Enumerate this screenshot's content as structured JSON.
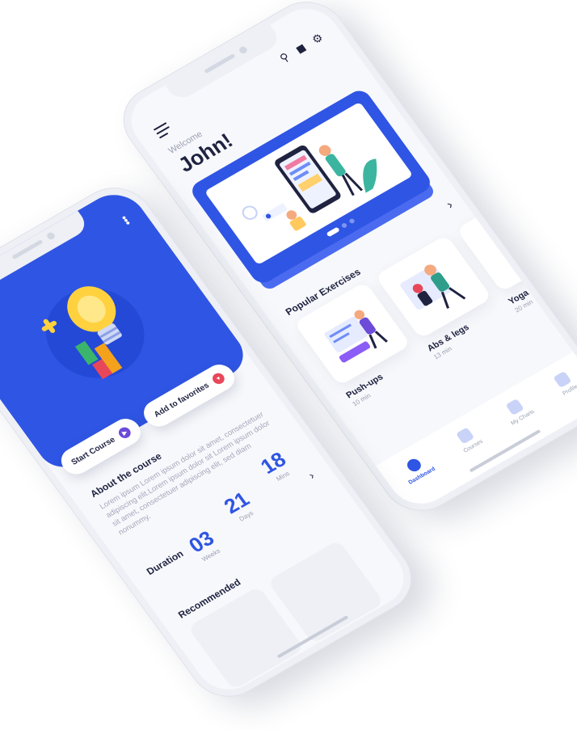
{
  "dashboard": {
    "welcome_label": "Welcome",
    "user_name": "John!",
    "section_title": "Popular Exercises",
    "exercises": [
      {
        "name": "Push-ups",
        "duration": "10 min"
      },
      {
        "name": "Abs & legs",
        "duration": "13 min"
      },
      {
        "name": "Yoga",
        "duration": "20 min"
      }
    ],
    "tabs": [
      {
        "label": "Dashboard",
        "active": true
      },
      {
        "label": "Courses",
        "active": false
      },
      {
        "label": "My Charts",
        "active": false
      },
      {
        "label": "Profile",
        "active": false
      }
    ],
    "top_icons": [
      "search-icon",
      "notification-bell-icon",
      "settings-gear-icon"
    ]
  },
  "course": {
    "start_button": "Start Course",
    "favorites_button": "Add to favorites",
    "about_title": "About the course",
    "about_text": "Lorem ipsum Lorem ipsum dolor sit amet, consectetuer adipiscing elit.Lorem ipsum dolor sit Lorem ipsum dolor sit amet, consectetuer adipiscing elit, sed diam nonummy.",
    "duration_label": "Duration",
    "weeks_value": "03",
    "weeks_unit": "Weeks",
    "days_value": "21",
    "days_unit": "Days",
    "mins_value": "18",
    "mins_unit": "Mins",
    "recommended_title": "Recommended"
  },
  "colors": {
    "accent": "#2f55e4",
    "favorite": "#e8475a",
    "play": "#6b4bd8"
  }
}
